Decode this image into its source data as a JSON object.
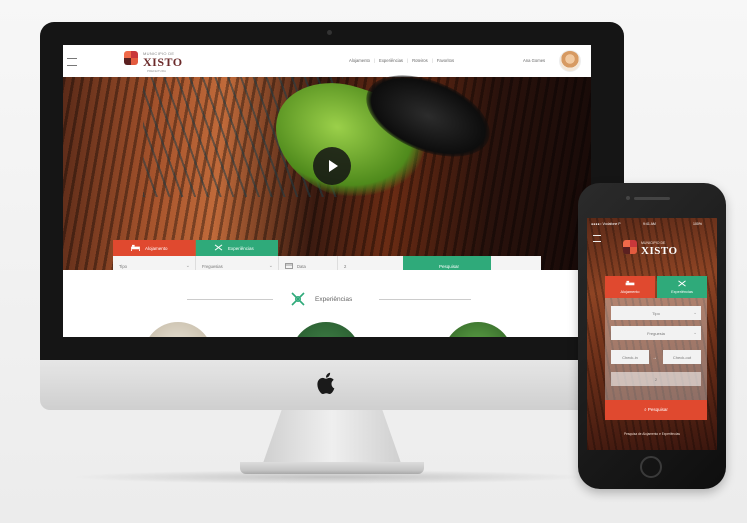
{
  "imac_site": {
    "brand": {
      "subtitle": "MUNICIPIO DE",
      "name": "XISTO",
      "tagline": "PREFEITURA"
    },
    "nav": {
      "items": [
        "Alojamento",
        "Experiências",
        "Roteiros",
        "Favoritos"
      ],
      "user_name": "Ana Gomes"
    },
    "tabs": {
      "lodging": "Alojamento",
      "experiences": "Experiências"
    },
    "search": {
      "field1": "Tipo",
      "field2": "Freguesias",
      "field3": "Data",
      "field4": "2",
      "button": "Pesquisar"
    },
    "section": {
      "title": "Experiências"
    }
  },
  "phone_site": {
    "status": {
      "carrier": "●●●●○ Vodafone P",
      "time": "9:41 AM",
      "battery": "100%"
    },
    "brand": {
      "subtitle": "MUNICIPIO DE",
      "name": "XISTO"
    },
    "tabs": {
      "lodging": "Alojamento",
      "experiences": "Experiências"
    },
    "form": {
      "type": "Tipo",
      "parish": "Freguesia",
      "check_in": "Check-in",
      "check_out": "Check-out",
      "guests": "2",
      "arrow": "→"
    },
    "search_button": "Pesquisar",
    "footer": "Pesquisa de Alojamento e Experiências"
  },
  "colors": {
    "accent_red": "#e0492f",
    "accent_green": "#2faa7a",
    "brand_dark": "#6b2a2a"
  }
}
